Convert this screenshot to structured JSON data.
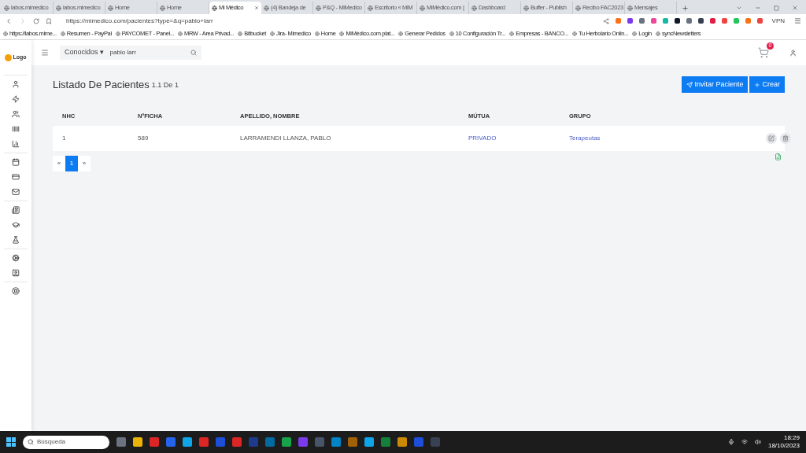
{
  "browser": {
    "tabs": [
      {
        "label": "labos.mimedico",
        "selected": false
      },
      {
        "label": "labos.mimedico",
        "selected": false
      },
      {
        "label": "Home",
        "selected": false
      },
      {
        "label": "Home",
        "selected": false
      },
      {
        "label": "Mi Médico",
        "selected": true
      },
      {
        "label": "(4) Bandeja de",
        "selected": false
      },
      {
        "label": "P&Q - MiMedico",
        "selected": false
      },
      {
        "label": "Escritorio « MiM",
        "selected": false
      },
      {
        "label": "MiMédico.com |",
        "selected": false
      },
      {
        "label": "Dashboard",
        "selected": false
      },
      {
        "label": "Buffer - Publish",
        "selected": false
      },
      {
        "label": "Recibo FAC2023",
        "selected": false
      },
      {
        "label": "Mensajes",
        "selected": false
      }
    ],
    "address": "https://mimedico.com/pacientes?type=&q=pablo+larr",
    "vpn": "VPN",
    "bookmarks": [
      "https://labos.mime...",
      "Resumen - PayPal",
      "PAYCOMET - Panel...",
      "MRW - Area Privad...",
      "Bitbucket",
      "Jira- Mimedico",
      "Home",
      "MiMédico.com plat...",
      "Generar Pedidos",
      "10 Configuración Tr...",
      "Empresas - BANCO...",
      "Tu Herbolario Onlin...",
      "Login",
      "syncNewsletters"
    ]
  },
  "app": {
    "logo": "Logo",
    "filter": "Conocidos",
    "filter_caret": "▾",
    "search_value": "pablo larr",
    "cart_badge": "0",
    "title": "Listado De Pacientes",
    "subtitle": "1.1 De 1",
    "buttons": [
      "Invitar Paciente",
      "Crear"
    ],
    "table": {
      "columns": [
        "NHC",
        "NºFICHA",
        "APELLIDO, NOMBRE",
        "MÚTUA",
        "GRUPO"
      ],
      "rows": [
        {
          "cells": [
            "1",
            "589",
            "LARRAMENDI LLANZA, PABLO",
            "PRIVADO",
            "Terapeutas"
          ]
        }
      ]
    },
    "pagination": [
      {
        "label": "«",
        "selected": false
      },
      {
        "label": "1",
        "selected": true
      },
      {
        "label": "»",
        "selected": false
      }
    ]
  },
  "taskbar": {
    "search_placeholder": "Búsqueda",
    "time": "18:29",
    "date": "18/10/2023"
  }
}
